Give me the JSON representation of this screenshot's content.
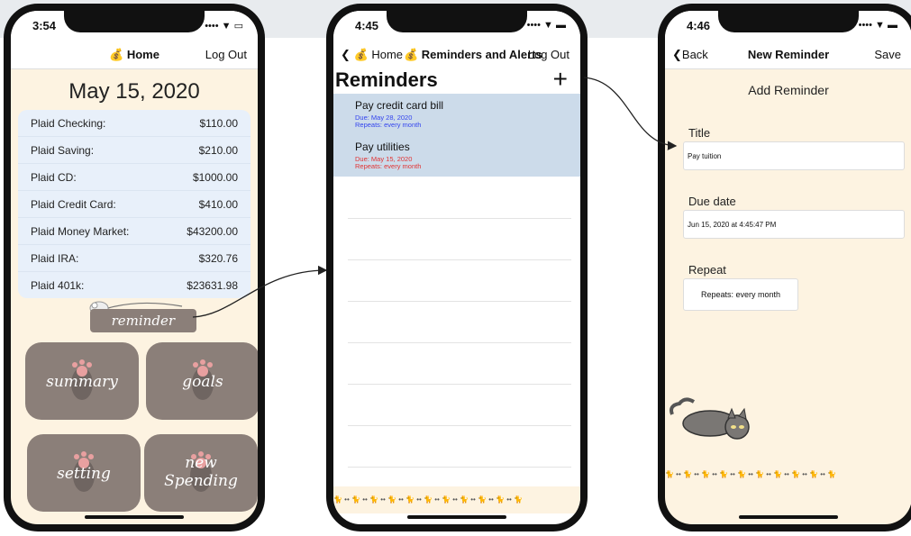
{
  "phones": [
    {
      "time": "3:54",
      "status_icons": "•••• ▼ ▭",
      "nav": {
        "title": "💰 Home",
        "right": "Log Out"
      },
      "date": "May 15, 2020",
      "accounts": [
        {
          "name": "Plaid Checking:",
          "amount": "$110.00"
        },
        {
          "name": "Plaid Saving:",
          "amount": "$210.00"
        },
        {
          "name": "Plaid CD:",
          "amount": "$1000.00"
        },
        {
          "name": "Plaid Credit Card:",
          "amount": "$410.00"
        },
        {
          "name": "Plaid Money Market:",
          "amount": "$43200.00"
        },
        {
          "name": "Plaid IRA:",
          "amount": "$320.76"
        },
        {
          "name": "Plaid 401k:",
          "amount": "$23631.98"
        }
      ],
      "reminder_button": "reminder",
      "tiles": [
        "summary",
        "goals",
        "setting",
        "new Spending"
      ]
    },
    {
      "time": "4:45",
      "status_icons": "•••• ▼ ▬",
      "nav": {
        "back": "Home",
        "title": "💰 Reminders and Alerts",
        "right": "Log Out",
        "back_icon": "💰"
      },
      "heading": "Reminders",
      "plus": "+",
      "reminders": [
        {
          "name": "Pay credit card bill",
          "due": "Due: May 28, 2020",
          "repeat": "Repeats: every month",
          "due_color": "#3344ee"
        },
        {
          "name": "Pay utilities",
          "due": "Due: May 15, 2020",
          "repeat": "Repeats: every month",
          "due_color": "#e23333"
        }
      ],
      "footer": "🐈 •• 🐈 •• 🐈 •• 🐈 •• 🐈 •• 🐈 •• 🐈 •• 🐈 •• 🐈 •• 🐈 •• 🐈"
    },
    {
      "time": "4:46",
      "status_icons": "•••• ▼ ▬",
      "nav": {
        "back": "Back",
        "title": "New Reminder",
        "right": "Save"
      },
      "heading": "Add Reminder",
      "title_label": "Title",
      "title_value": "Pay tuition",
      "due_label": "Due date",
      "due_value": "Jun 15, 2020 at 4:45:47 PM",
      "repeat_label": "Repeat",
      "repeat_value": "Repeats: every month",
      "footer": "🐈 •• 🐈 •• 🐈 •• 🐈 •• 🐈 •• 🐈 •• 🐈 •• 🐈 •• 🐈 •• 🐈"
    }
  ]
}
